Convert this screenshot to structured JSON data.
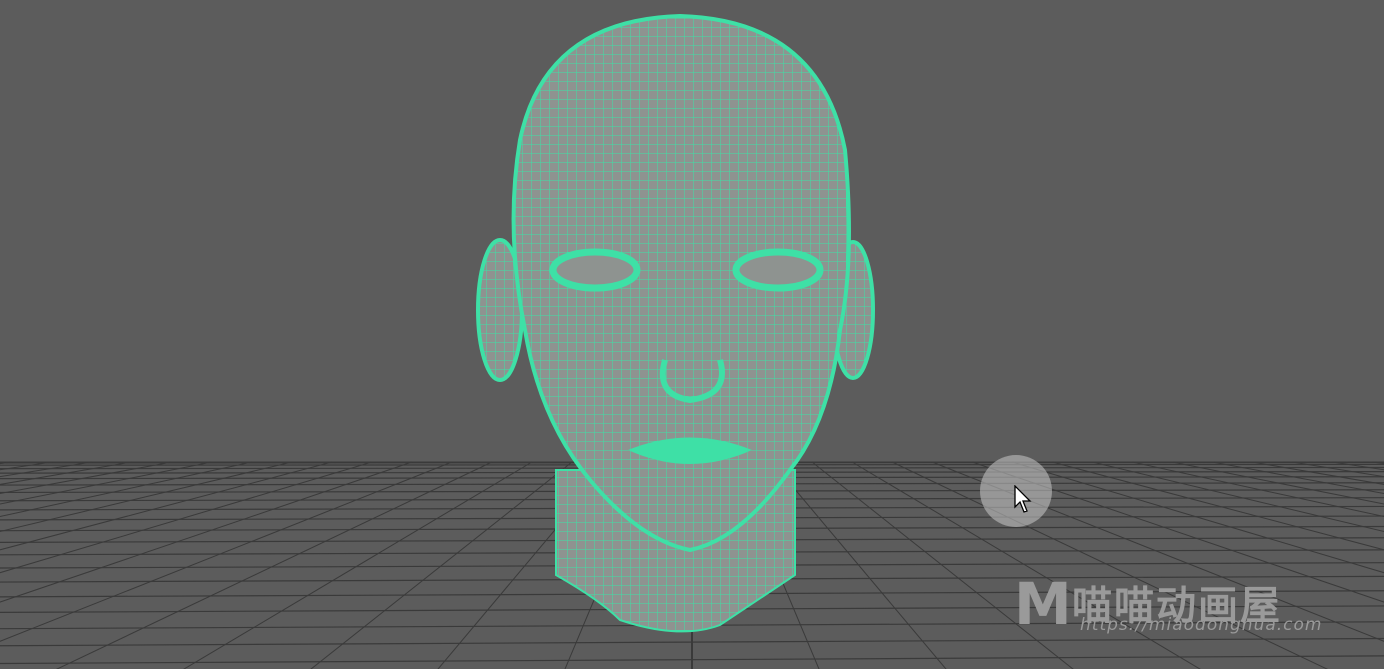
{
  "viewport": {
    "background": "#5c5c5c",
    "grid_color": "#3a3a3a",
    "wireframe_color": "#3ee0a6",
    "mesh_fill": "#8e9390"
  },
  "watermark": {
    "letter": "M",
    "name": "喵喵动画屋",
    "url": "https://miaodonghua.com"
  },
  "cursor_icon": "arrow-pointer-icon"
}
